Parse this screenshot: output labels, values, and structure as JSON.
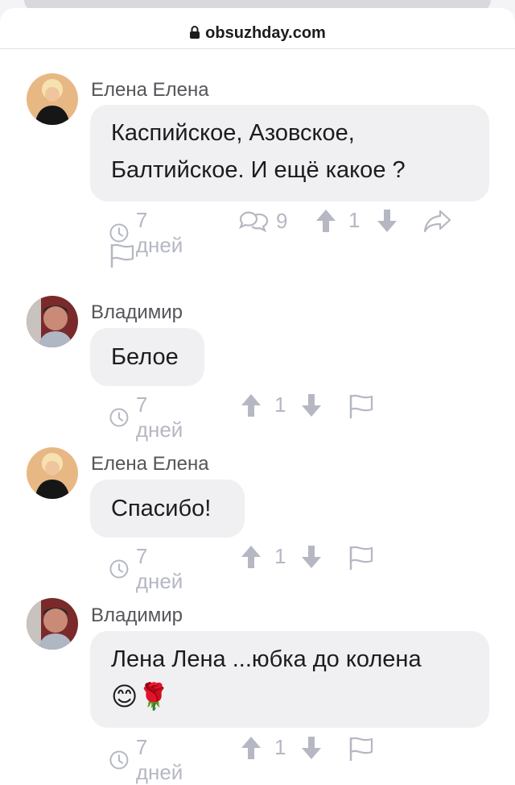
{
  "browser": {
    "url": "obsuzhday.com"
  },
  "comments": [
    {
      "author": "Елена Елена",
      "text_lines": [
        "Каспийское, Азовское,",
        "Балтийское. И ещё какое ?"
      ],
      "time": "7 дней",
      "replies": "9",
      "votes": "1"
    },
    {
      "author": "Владимир",
      "text_lines": [
        "Белое"
      ],
      "time": "7 дней",
      "votes": "1"
    },
    {
      "author": "Елена Елена",
      "text_lines": [
        "Спасибо!"
      ],
      "time": "7 дней",
      "votes": "1"
    },
    {
      "author": "Владимир",
      "text_lines": [
        "Лена Лена ...юбка до колена",
        "😊🌹"
      ],
      "time": "7 дней",
      "votes": "1"
    }
  ],
  "icons": {
    "clock": "clock-icon",
    "replies": "speech-bubbles-icon",
    "upvote": "arrow-up-icon",
    "downvote": "arrow-down-icon",
    "share": "share-icon",
    "flag": "flag-icon",
    "lock": "lock-icon"
  },
  "colors": {
    "bubble": "#f0f0f2",
    "meta": "#b5b8c2",
    "author": "#55555a",
    "text": "#1c1c1e"
  }
}
